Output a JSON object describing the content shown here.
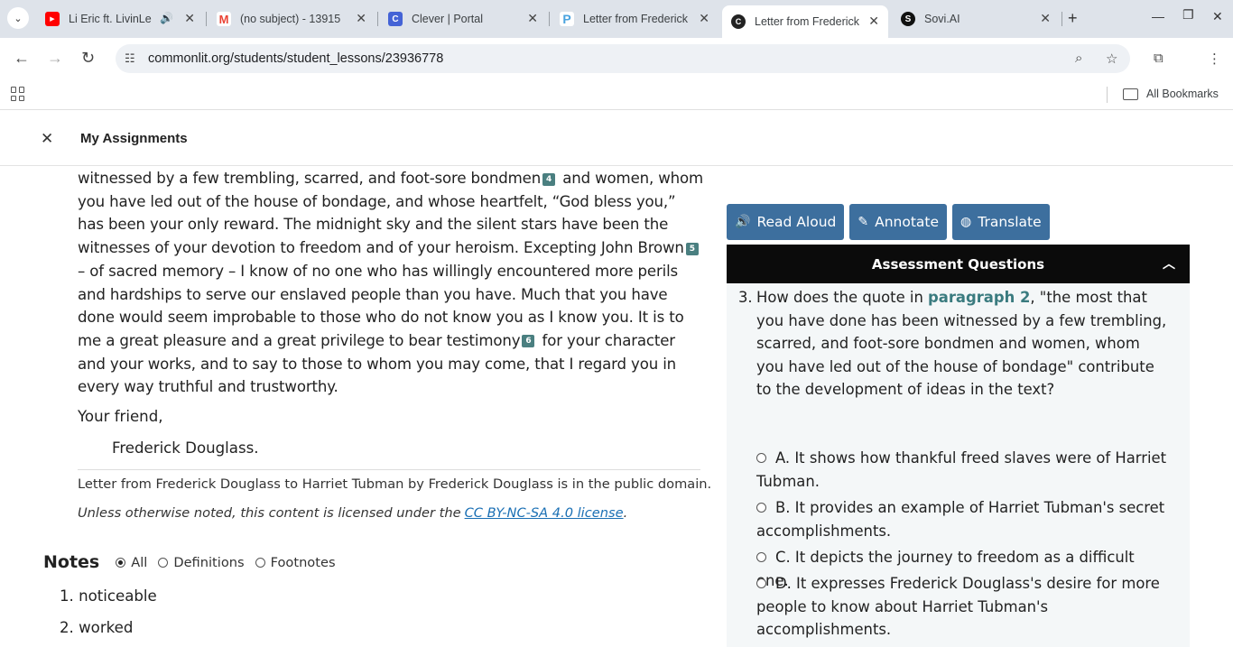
{
  "browser": {
    "tabs": [
      {
        "title": "Li Eric ft. LivinLe",
        "fav_color": "#ff0000",
        "fav_glyph": "▶"
      },
      {
        "title": "(no subject) - 13915",
        "fav_color": "#ea4335",
        "fav_glyph": "M"
      },
      {
        "title": "Clever | Portal",
        "fav_color": "#4463d6",
        "fav_glyph": "C"
      },
      {
        "title": "Letter from Frederick",
        "fav_color": "#4aa3df",
        "fav_glyph": "P"
      },
      {
        "title": "Letter from Frederick",
        "fav_color": "#222222",
        "fav_glyph": "C"
      },
      {
        "title": "Sovi.AI",
        "fav_color": "#111111",
        "fav_glyph": "S"
      }
    ],
    "url": "commonlit.org/students/student_lessons/23936778",
    "all_bookmarks": "All Bookmarks"
  },
  "header": {
    "title": "My Assignments"
  },
  "reading": {
    "p1_a": "witnessed by a few trembling, scarred, and foot-sore bondmen",
    "fn4": "4",
    "p1_b": " and women, whom you have led out of the house of bondage, and whose heartfelt, “God bless you,” has been your only reward. The midnight sky and the silent stars have been the witnesses of your devotion to freedom and of your heroism. Excepting John Brown",
    "fn5": "5",
    "p1_c": " – of sacred memory – I know of no one who has willingly encountered more perils and hardships to serve our enslaved people than you have. Much that you have done would seem improbable to those who do not know you as I know you. It is to me a great pleasure and a great privilege to bear testimony",
    "fn6": "6",
    "p1_d": " for your character and your works, and to say to those to whom you may come, that I regard you in every way truthful and trustworthy.",
    "closing": "Your friend,",
    "signature": "Frederick Douglass.",
    "license1": "Letter from Frederick Douglass to Harriet Tubman by Frederick Douglass is in the public domain.",
    "license2": "Unless otherwise noted, this content is licensed under the",
    "license_link": "CC BY-NC-SA 4.0 license",
    "license_end": "."
  },
  "notes": {
    "heading": "Notes",
    "filters": [
      "All",
      "Definitions",
      "Footnotes"
    ],
    "items": [
      "1. noticeable",
      "2. worked"
    ]
  },
  "tools": {
    "read_aloud": "Read Aloud",
    "annotate": "Annotate",
    "translate": "Translate"
  },
  "assessment": {
    "heading": "Assessment Questions",
    "number": "3.",
    "q_pre": "How does the quote in ",
    "q_link": "paragraph 2",
    "q_post": ", \"the most that you have done has been witnessed by a few trembling, scarred, and foot-sore bondmen and women, whom you have led out of the house of bondage\" contribute to the development of ideas in the text?",
    "choices": [
      "A. It shows how thankful freed slaves were of Harriet Tubman.",
      "B. It provides an example of Harriet Tubman's secret accomplishments.",
      "C. It depicts the journey to freedom as a difficult one.",
      "D. It expresses Frederick Douglass's desire for more people to know about Harriet Tubman's accomplishments."
    ]
  },
  "colors": {
    "tool_button": "#3d6f9e",
    "footnote_badge": "#4a7f80",
    "link_teal": "#3a7b7f"
  }
}
